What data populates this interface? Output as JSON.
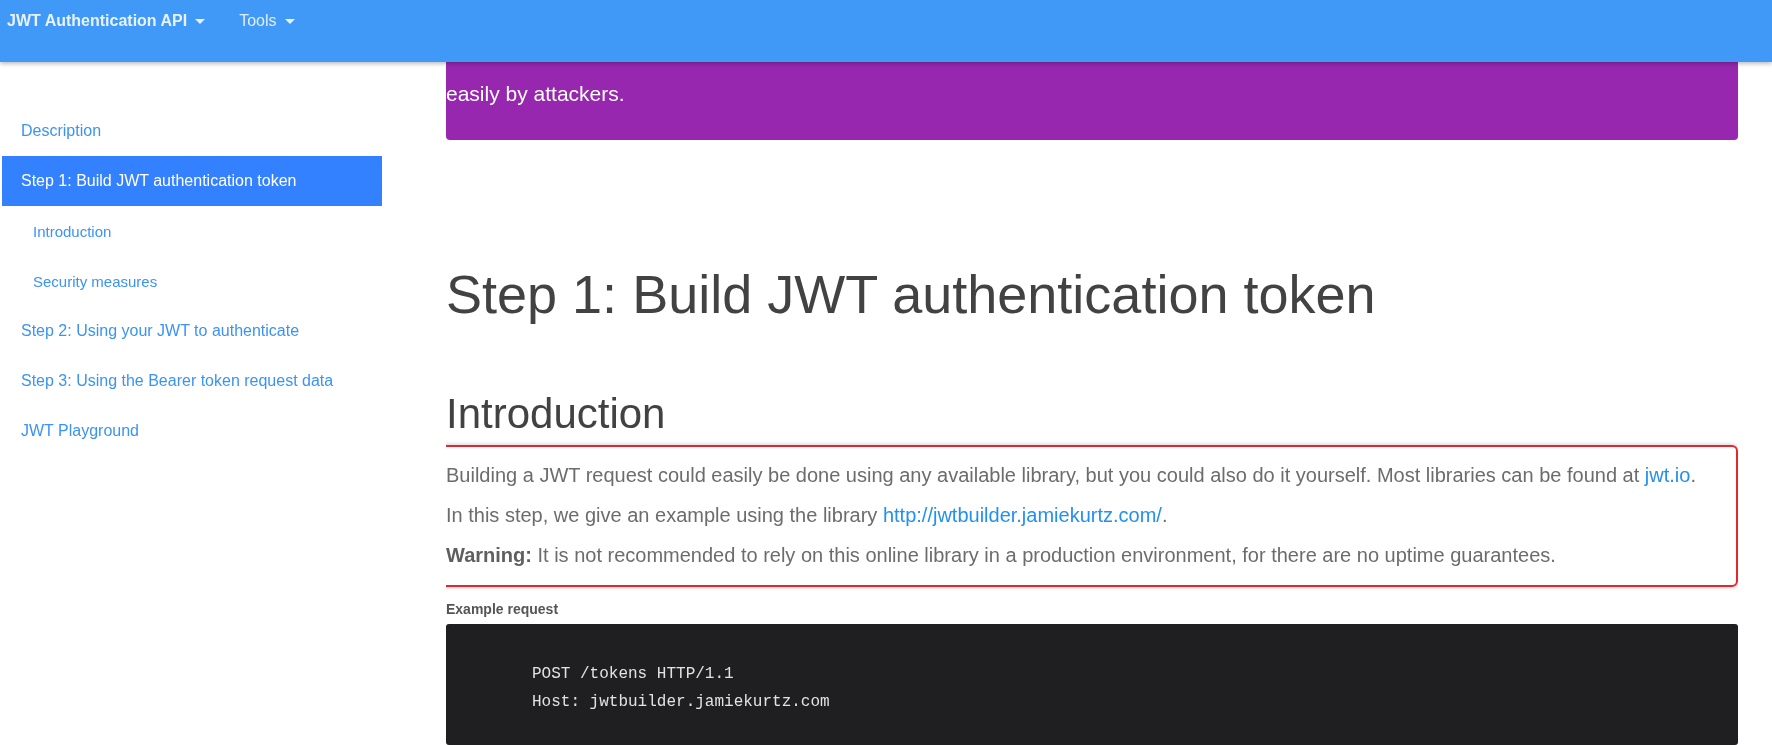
{
  "navbar": {
    "menus": [
      {
        "label": "JWT Authentication API",
        "bold": true
      },
      {
        "label": "Tools",
        "bold": false
      }
    ]
  },
  "sidebar": {
    "items": [
      {
        "label": "Description",
        "selected": false
      },
      {
        "label": "Step 1: Build JWT authentication token",
        "selected": true,
        "children": [
          {
            "label": "Introduction",
            "selected": false
          },
          {
            "label": "Security measures",
            "selected": false
          }
        ]
      },
      {
        "label": "Step 2: Using your JWT to authenticate",
        "selected": false
      },
      {
        "label": "Step 3: Using the Bearer token request data",
        "selected": false
      },
      {
        "label": "JWT Playground",
        "selected": false
      }
    ]
  },
  "notice": {
    "text": "easily by attackers."
  },
  "heading": "Step 1: Build JWT authentication token",
  "subheading": "Introduction",
  "highlight_box": {
    "paragraph": [
      {
        "kind": "text",
        "text": "Building a JWT request could easily be done using any available library, but you could also do it yourself. Most libraries can be found at "
      },
      {
        "kind": "link",
        "text": "jwt.io"
      },
      {
        "kind": "text",
        "text": ". In this step, we give an example using the library "
      },
      {
        "kind": "link",
        "text": "http://jwtbuilder.jamiekurtz.com/"
      },
      {
        "kind": "text",
        "text": "."
      }
    ],
    "warning": "**Warning:** It is not recommended to rely on this online library in a production environment, for there are no uptime guarantees."
  },
  "example": {
    "label": "Example request",
    "code_lines": [
      "POST /tokens HTTP/1.1",
      "Host: jwtbuilder.jamiekurtz.com"
    ]
  }
}
